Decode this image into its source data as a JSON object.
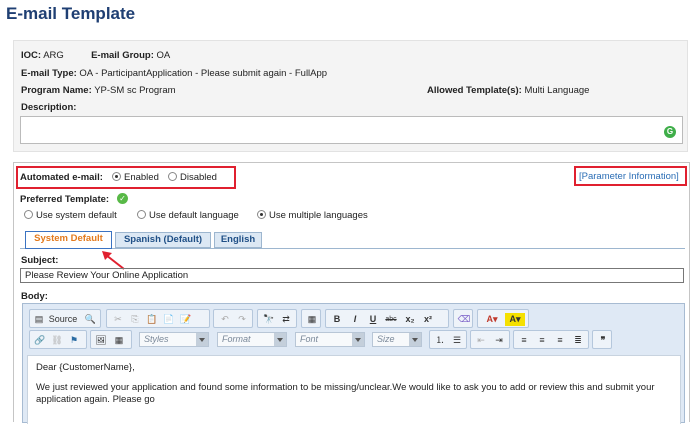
{
  "page": {
    "title": "E-mail Template"
  },
  "info": {
    "ioc_label": "IOC:",
    "ioc_value": "ARG",
    "group_label": "E-mail Group:",
    "group_value": "OA",
    "type_label": "E-mail Type:",
    "type_value": "OA - ParticipantApplication - Please submit again - FullApp",
    "program_label": "Program Name:",
    "program_value": "YP-SM sc Program",
    "allowed_label": "Allowed Template(s):",
    "allowed_value": "Multi Language",
    "description_label": "Description:",
    "description_value": ""
  },
  "automated": {
    "label": "Automated e-mail:",
    "options": [
      "Enabled",
      "Disabled"
    ],
    "selected": "Enabled"
  },
  "parameter_link": "[Parameter Information]",
  "preferred": {
    "label": "Preferred Template:",
    "options": [
      "Use system default",
      "Use default language",
      "Use multiple languages"
    ],
    "selected": "Use multiple languages"
  },
  "tabs": [
    "System Default",
    "Spanish (Default)",
    "English"
  ],
  "active_tab": "System Default",
  "subject": {
    "label": "Subject:",
    "value": "Please Review Your Online Application"
  },
  "body_label": "Body:",
  "toolbar": {
    "source_label": "Source",
    "styles": "Styles",
    "format": "Format",
    "font": "Font",
    "size": "Size",
    "bold": "B",
    "italic": "I",
    "underline": "U",
    "strike": "abc",
    "subscript": "x₂",
    "superscript": "x²",
    "quote": "❞"
  },
  "editor_body": {
    "greeting": "Dear {CustomerName},",
    "paragraph": "We just reviewed your application and found some information to be missing/unclear.We would like to ask you to add or review this and submit your application again. Please go"
  },
  "colors": {
    "title": "#1f3f73",
    "highlight_border": "#e0202f",
    "active_tab_text": "#e37a1d",
    "link": "#2a6db5"
  }
}
